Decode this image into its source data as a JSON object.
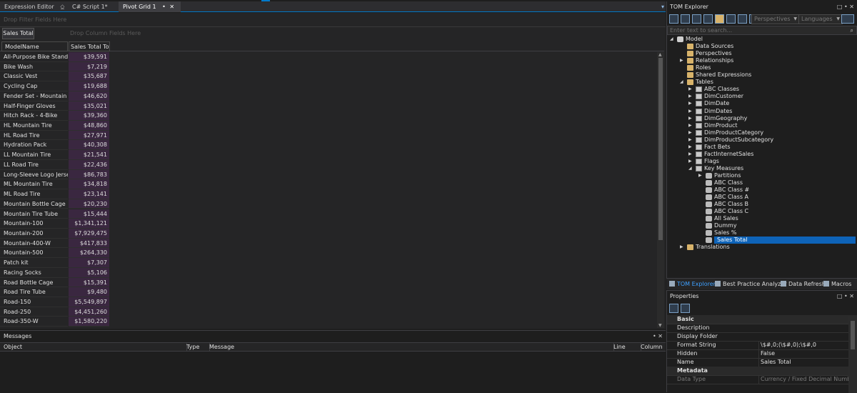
{
  "tabs": [
    {
      "label": "Expression Editor",
      "suffix": "⎐"
    },
    {
      "label": "C# Script 1*"
    },
    {
      "label": "Pivot Grid 1",
      "pin": "•",
      "close": "✕"
    }
  ],
  "pivot": {
    "filter_drop": "Drop Filter Fields Here",
    "data_field": "Sales Total",
    "column_drop": "Drop Column Fields Here",
    "headers": {
      "row": "ModelName",
      "value": "Sales Total Total"
    },
    "rows": [
      {
        "name": "All-Purpose Bike Stand",
        "value": "$39,591"
      },
      {
        "name": "Bike Wash",
        "value": "$7,219"
      },
      {
        "name": "Classic Vest",
        "value": "$35,687"
      },
      {
        "name": "Cycling Cap",
        "value": "$19,688"
      },
      {
        "name": "Fender Set - Mountain",
        "value": "$46,620"
      },
      {
        "name": "Half-Finger Gloves",
        "value": "$35,021"
      },
      {
        "name": "Hitch Rack - 4-Bike",
        "value": "$39,360"
      },
      {
        "name": "HL Mountain Tire",
        "value": "$48,860"
      },
      {
        "name": "HL Road Tire",
        "value": "$27,971"
      },
      {
        "name": "Hydration Pack",
        "value": "$40,308"
      },
      {
        "name": "LL Mountain Tire",
        "value": "$21,541"
      },
      {
        "name": "LL Road Tire",
        "value": "$22,436"
      },
      {
        "name": "Long-Sleeve Logo Jersey",
        "value": "$86,783"
      },
      {
        "name": "ML Mountain Tire",
        "value": "$34,818"
      },
      {
        "name": "ML Road Tire",
        "value": "$23,141"
      },
      {
        "name": "Mountain Bottle Cage",
        "value": "$20,230"
      },
      {
        "name": "Mountain Tire Tube",
        "value": "$15,444"
      },
      {
        "name": "Mountain-100",
        "value": "$1,341,121"
      },
      {
        "name": "Mountain-200",
        "value": "$7,929,475"
      },
      {
        "name": "Mountain-400-W",
        "value": "$417,833"
      },
      {
        "name": "Mountain-500",
        "value": "$264,330"
      },
      {
        "name": "Patch kit",
        "value": "$7,307"
      },
      {
        "name": "Racing Socks",
        "value": "$5,106"
      },
      {
        "name": "Road Bottle Cage",
        "value": "$15,391"
      },
      {
        "name": "Road Tire Tube",
        "value": "$9,480"
      },
      {
        "name": "Road-150",
        "value": "$5,549,897"
      },
      {
        "name": "Road-250",
        "value": "$4,451,260"
      },
      {
        "name": "Road-350-W",
        "value": "$1,580,220"
      }
    ]
  },
  "messages": {
    "title": "Messages",
    "controls": "• ✕",
    "columns": [
      "Object",
      "Type",
      "Message",
      "Line",
      "Column"
    ]
  },
  "tom": {
    "title": "TOM Explorer",
    "controls": "□ • ✕",
    "perspectives": "Perspectives",
    "languages": "Languages",
    "search_placeholder": "Enter text to search...",
    "search_icon": "⌕",
    "tree": [
      {
        "label": "Model",
        "icon": "model",
        "arrow": "◢",
        "depth": 1
      },
      {
        "label": "Data Sources",
        "icon": "folder",
        "depth": 2
      },
      {
        "label": "Perspectives",
        "icon": "folder",
        "depth": 2
      },
      {
        "label": "Relationships",
        "icon": "folder",
        "arrow": "▶",
        "depth": 2
      },
      {
        "label": "Roles",
        "icon": "folder",
        "depth": 2
      },
      {
        "label": "Shared Expressions",
        "icon": "folder",
        "depth": 2
      },
      {
        "label": "Tables",
        "icon": "folder",
        "arrow": "◢",
        "depth": 2
      },
      {
        "label": "ABC Classes",
        "icon": "table",
        "arrow": "▶",
        "depth": 3
      },
      {
        "label": "DimCustomer",
        "icon": "table",
        "arrow": "▶",
        "depth": 3
      },
      {
        "label": "DimDate",
        "icon": "table",
        "arrow": "▶",
        "depth": 3
      },
      {
        "label": "DimDates",
        "icon": "table",
        "arrow": "▶",
        "depth": 3
      },
      {
        "label": "DimGeography",
        "icon": "table",
        "arrow": "▶",
        "depth": 3
      },
      {
        "label": "DimProduct",
        "icon": "table",
        "arrow": "▶",
        "depth": 3
      },
      {
        "label": "DimProductCategory",
        "icon": "table",
        "arrow": "▶",
        "depth": 3
      },
      {
        "label": "DimProductSubcategory",
        "icon": "table",
        "arrow": "▶",
        "depth": 3
      },
      {
        "label": "Fact Bets",
        "icon": "table",
        "arrow": "▶",
        "depth": 3
      },
      {
        "label": "FactInternetSales",
        "icon": "table",
        "arrow": "▶",
        "depth": 3
      },
      {
        "label": "Flags",
        "icon": "table",
        "arrow": "▶",
        "depth": 3
      },
      {
        "label": "Key Measures",
        "icon": "table",
        "arrow": "◢",
        "depth": 3
      },
      {
        "label": "Partitions",
        "icon": "measure",
        "arrow": "▶",
        "depth": 4
      },
      {
        "label": "ABC Class",
        "icon": "measure",
        "depth": 4
      },
      {
        "label": "ABC Class #",
        "icon": "measure",
        "depth": 4
      },
      {
        "label": "ABC Class A",
        "icon": "measure",
        "depth": 4
      },
      {
        "label": "ABC Class B",
        "icon": "measure",
        "depth": 4
      },
      {
        "label": "ABC Class C",
        "icon": "measure",
        "depth": 4
      },
      {
        "label": "All Sales",
        "icon": "measure",
        "depth": 4
      },
      {
        "label": "Dummy",
        "icon": "measure",
        "depth": 4
      },
      {
        "label": "Sales %",
        "icon": "measure",
        "depth": 4
      },
      {
        "label": "Sales Total",
        "icon": "measure",
        "depth": 4,
        "selected": true
      },
      {
        "label": "Translations",
        "icon": "folder",
        "arrow": "▶",
        "depth": 2
      }
    ],
    "bottom_tabs": [
      "TOM Explorer",
      "Best Practice Analyzer",
      "Data Refresh",
      "Macros"
    ]
  },
  "properties": {
    "title": "Properties",
    "controls": "□ • ✕",
    "rows": [
      {
        "key": "Basic",
        "value": "",
        "category": true
      },
      {
        "key": "Description",
        "value": ""
      },
      {
        "key": "Display Folder",
        "value": ""
      },
      {
        "key": "Format String",
        "value": "\\$#,0;(\\$#,0);\\$#,0"
      },
      {
        "key": "Hidden",
        "value": "False"
      },
      {
        "key": "Name",
        "value": "Sales Total"
      },
      {
        "key": "Metadata",
        "value": "",
        "category": true
      },
      {
        "key": "Data Type",
        "value": "Currency / Fixed Decimal Number (de",
        "dim": true
      }
    ]
  },
  "colors": {
    "accent": "#007acc",
    "selection": "#0e63b8",
    "value_cell": "#3a2740"
  }
}
